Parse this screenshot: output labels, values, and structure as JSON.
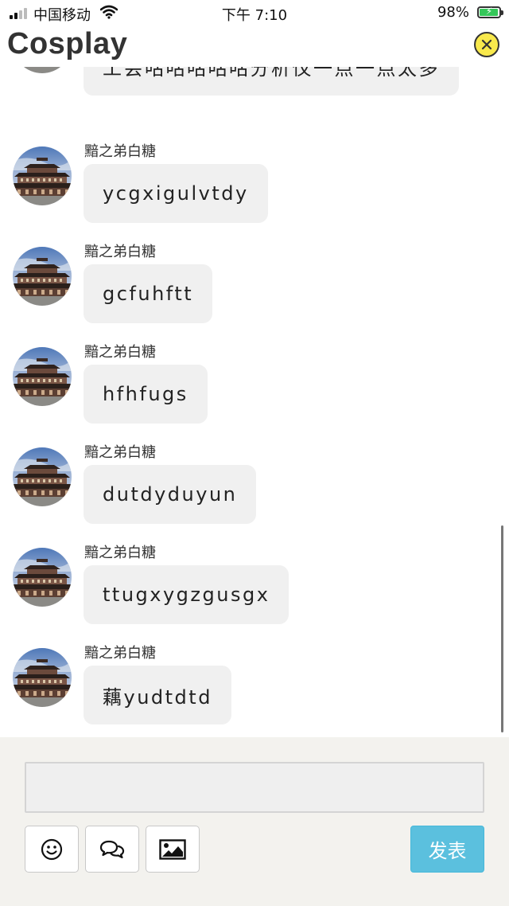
{
  "status_bar": {
    "carrier": "中国移动",
    "time": "下午 7:10",
    "battery_percent": "98%",
    "battery_level": 0.98,
    "signal_icon": "signal-bars-icon",
    "wifi_icon": "wifi-icon",
    "battery_icon": "battery-charging-icon"
  },
  "header": {
    "title": "Cosplay",
    "close_icon": "close-circle-icon",
    "close_color": "#f8e94c"
  },
  "messages": [
    {
      "sender": "",
      "text": "工会咕咕咕咕咕分析仪一点一点太多"
    },
    {
      "sender": "黯之弟白糖",
      "text": "ycgxigulvtdy"
    },
    {
      "sender": "黯之弟白糖",
      "text": "gcfuhftt"
    },
    {
      "sender": "黯之弟白糖",
      "text": "hfhfugs"
    },
    {
      "sender": "黯之弟白糖",
      "text": "dutdyduyun"
    },
    {
      "sender": "黯之弟白糖",
      "text": "ttugxygzgusgx"
    },
    {
      "sender": "黯之弟白糖",
      "text": "藕yudtdtd"
    }
  ],
  "composer": {
    "input_value": "",
    "emoji_icon": "smiley-icon",
    "chat_icon": "chat-bubbles-icon",
    "image_icon": "image-icon",
    "send_label": "发表",
    "send_color": "#5bc0de"
  }
}
